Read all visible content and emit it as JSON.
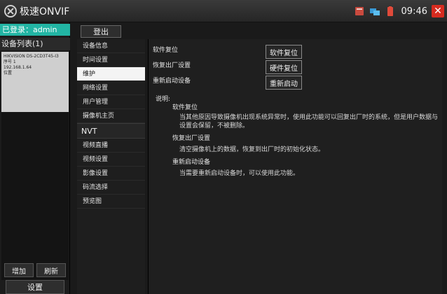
{
  "titlebar": {
    "app_title": "极速ONVIF",
    "clock": "09:46",
    "icons": [
      "app-logo-icon",
      "sd-card-icon",
      "network-icon",
      "battery-icon",
      "close-icon"
    ],
    "close_symbol": "✕"
  },
  "left": {
    "login_status": "已登录：admin",
    "device_list_header": "设备列表(1)",
    "device": {
      "name": "HIKVISION DS-2CD3T45-I3",
      "serial": "序号 1",
      "ip": "192.168.1.64",
      "location": "位置"
    },
    "add_label": "增加",
    "refresh_label": "刷新",
    "settings_label": "设置"
  },
  "toolbar": {
    "logout_label": "登出"
  },
  "menu": {
    "items": [
      "设备信息",
      "时间设置",
      "维护",
      "网络设置",
      "用户管理",
      "摄像机主页"
    ],
    "active_index": 2,
    "nvt_header": "NVT",
    "nvt_items": [
      "视频直播",
      "视频设置",
      "影像设置",
      "码流选择",
      "预览图"
    ]
  },
  "main": {
    "actions": [
      {
        "label": "软件复位",
        "button": "软件复位"
      },
      {
        "label": "恢复出厂设置",
        "button": "硬件复位"
      },
      {
        "label": "重新启动设备",
        "button": "重新启动"
      }
    ],
    "description_title": "说明:",
    "descriptions": [
      {
        "title": "软件复位",
        "text": "当其他原因导致摄像机出现系统异常时，使用此功能可以回复出厂时的系统，但是用户数据与设置会保留，不被删除。"
      },
      {
        "title": "恢复出厂设置",
        "text": "清空摄像机上的数据，恢复到出厂时的初始化状态。"
      },
      {
        "title": "重新启动设备",
        "text": "当需要重新启动设备时，可以使用此功能。"
      }
    ]
  },
  "colors": {
    "accent": "#22b5a4",
    "close": "#d62b1f"
  }
}
